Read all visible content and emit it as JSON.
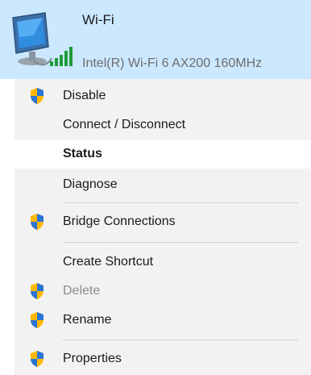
{
  "adapter": {
    "name": "Wi-Fi",
    "description": "Intel(R) Wi-Fi 6 AX200 160MHz",
    "icon": "network-adapter-icon",
    "signal_icon": "wifi-signal-icon"
  },
  "menu": {
    "items": [
      {
        "label": "Disable",
        "icon": "uac-shield-icon",
        "state": "normal"
      },
      {
        "label": "Connect / Disconnect",
        "icon": "",
        "state": "normal"
      },
      {
        "label": "Status",
        "icon": "",
        "state": "default-highlighted"
      },
      {
        "label": "Diagnose",
        "icon": "",
        "state": "normal"
      },
      {
        "label": "Bridge Connections",
        "icon": "uac-shield-icon",
        "state": "normal"
      },
      {
        "label": "Create Shortcut",
        "icon": "",
        "state": "normal"
      },
      {
        "label": "Delete",
        "icon": "uac-shield-icon",
        "state": "disabled"
      },
      {
        "label": "Rename",
        "icon": "uac-shield-icon",
        "state": "normal"
      },
      {
        "label": "Properties",
        "icon": "uac-shield-icon",
        "state": "normal"
      }
    ]
  },
  "colors": {
    "tile_selected_bg": "#cce8ff",
    "menu_bg": "#f2f2f2",
    "highlight_bg": "#ffffff",
    "disabled_text": "#8c8c8c"
  }
}
